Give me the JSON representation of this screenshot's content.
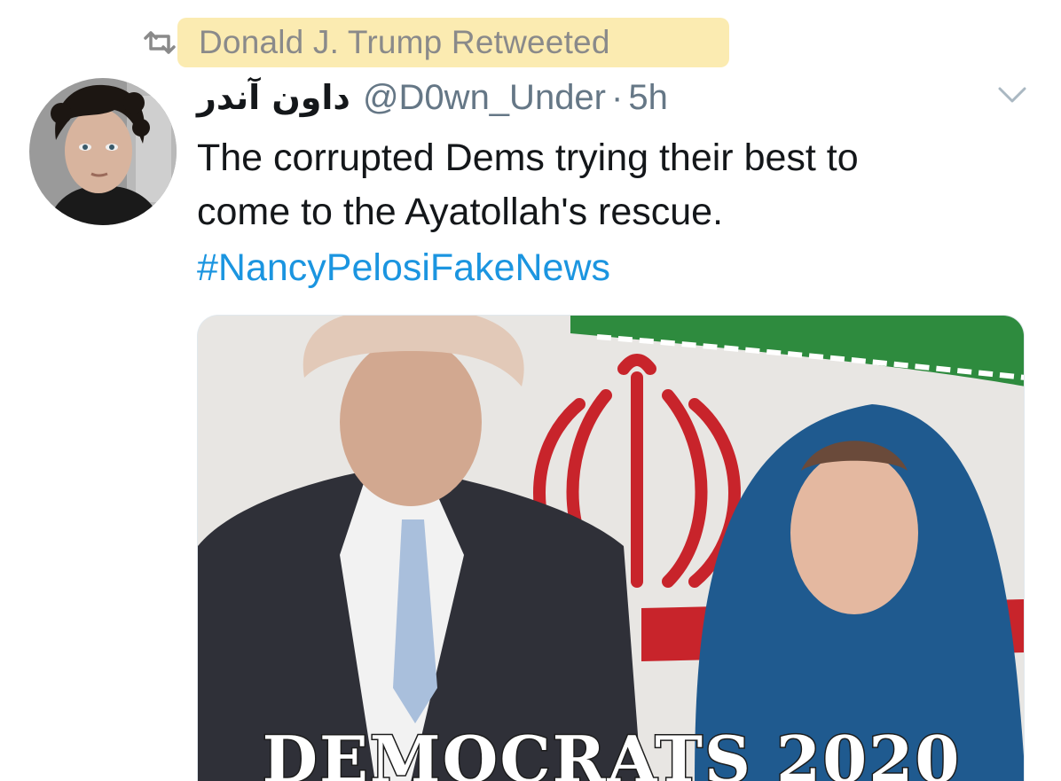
{
  "retweet": {
    "icon": "retweet-icon",
    "text": "Donald J. Trump Retweeted"
  },
  "tweet": {
    "avatar_icon": "user-avatar",
    "display_name": "داون آندر",
    "handle": "@D0wn_Under",
    "separator": "·",
    "time": "5h",
    "caret_icon": "chevron-down-icon",
    "text_lines": [
      "The corrupted Dems trying their best to",
      "come to the Ayatollah's rescue."
    ],
    "hashtag": "#NancyPelosiFakeNews",
    "media": {
      "caption": "DEMOCRATS 2020"
    }
  },
  "colors": {
    "highlight": "#fbe9a8",
    "hashtag": "#1b95e0",
    "muted": "#657786"
  }
}
